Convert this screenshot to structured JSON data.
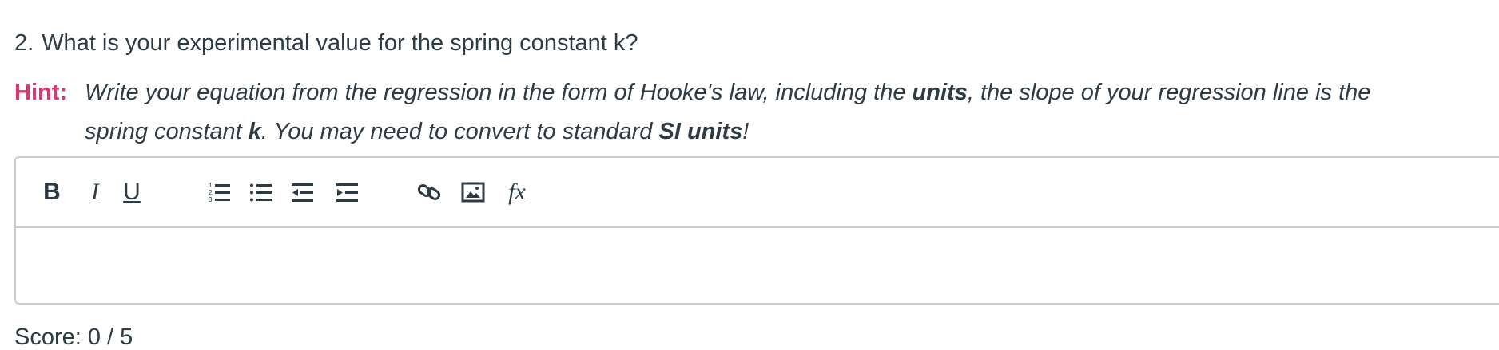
{
  "question": {
    "number": "2.",
    "text": "What is your experimental value for the spring constant k?"
  },
  "hint": {
    "label": "Hint:",
    "line1": {
      "a": "Write your equation from the regression in the form of Hooke's law, including the ",
      "b": "units",
      "c": ", the slope of your regression line is the"
    },
    "line2": {
      "a": "spring constant ",
      "b": "k",
      "c": ". You may need to convert to standard ",
      "d": "SI units",
      "e": "!"
    }
  },
  "toolbar": {
    "bold": "B",
    "italic": "I",
    "underline": "U",
    "formula": "fx"
  },
  "icons": {
    "bold": "bold-icon",
    "italic": "italic-icon",
    "underline": "underline-icon",
    "ordered_list": "ordered-list-icon",
    "bullet_list": "bullet-list-icon",
    "outdent": "outdent-icon",
    "indent": "indent-icon",
    "link": "link-icon",
    "image": "image-icon",
    "formula": "formula-icon"
  },
  "colors": {
    "hint_label": "#d63a6c",
    "text": "#2d3b45",
    "border": "#c7cdd1"
  },
  "footer_partial": "Score: 0 / 5"
}
